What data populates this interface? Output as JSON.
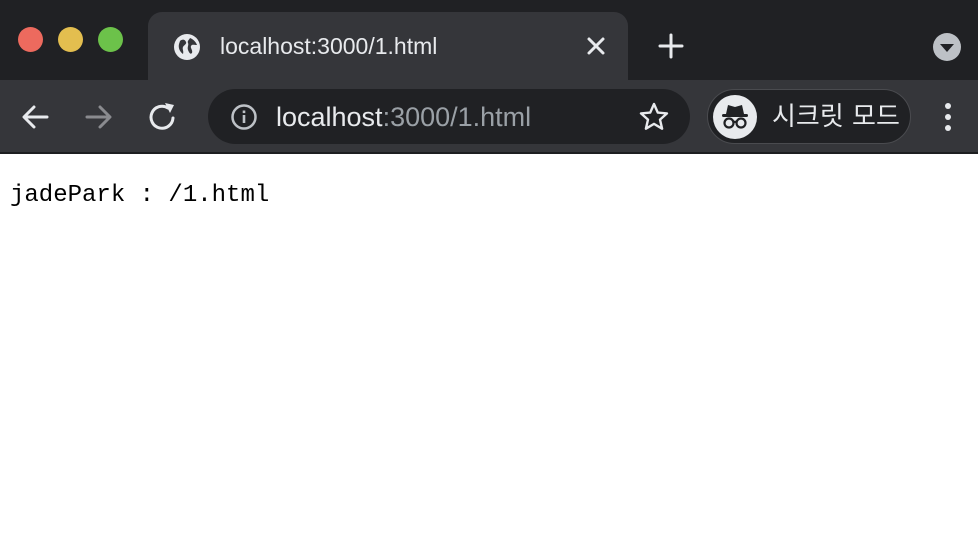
{
  "window": {
    "traffic_lights": {
      "close": "#ed6a5e",
      "minimize": "#e3be4f",
      "maximize": "#6cc24a"
    }
  },
  "tab": {
    "title": "localhost:3000/1.html",
    "icon": "globe-icon"
  },
  "toolbar": {
    "url_host": "localhost",
    "url_rest": ":3000/1.html",
    "incognito_label": "시크릿 모드"
  },
  "page": {
    "text": "jadePark : /1.html"
  },
  "colors": {
    "frame": "#202124",
    "toolbar": "#35363a",
    "text_light": "#e8eaed",
    "text_dim": "#9aa0a6"
  }
}
